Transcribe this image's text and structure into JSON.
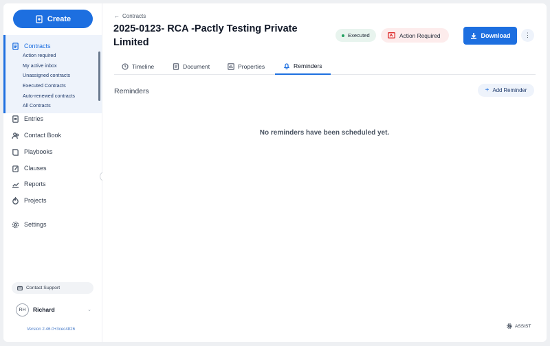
{
  "sidebar": {
    "create_label": "Create",
    "nav": {
      "contracts": "Contracts",
      "entries": "Entries",
      "contact_book": "Contact Book",
      "playbooks": "Playbooks",
      "clauses": "Clauses",
      "reports": "Reports",
      "projects": "Projects",
      "settings": "Settings"
    },
    "contract_filters": [
      "Action required",
      "My active inbox",
      "Unassigned contracts",
      "Executed Contracts",
      "Auto-renewed contracts",
      "All Contracts"
    ],
    "support_label": "Contact Support",
    "user": {
      "initials": "RH",
      "name": "Richard"
    },
    "version": "Version 2.46.0+3cec4826"
  },
  "header": {
    "breadcrumb": "Contracts",
    "title": "2025-0123- RCA -Pactly Testing Private Limited",
    "status_badge": "Executed",
    "action_badge": "Action Required",
    "download_label": "Download"
  },
  "tabs": [
    "Timeline",
    "Document",
    "Properties",
    "Reminders"
  ],
  "active_tab": "Reminders",
  "reminders": {
    "section_title": "Reminders",
    "add_label": "Add Reminder",
    "empty_message": "No reminders have been scheduled yet."
  },
  "assist_label": "ASSIST",
  "colors": {
    "primary": "#1d6fe0",
    "executed_dot": "#22a060",
    "action_icon": "#dc2626",
    "active_nav_bg": "#eef3fb"
  }
}
